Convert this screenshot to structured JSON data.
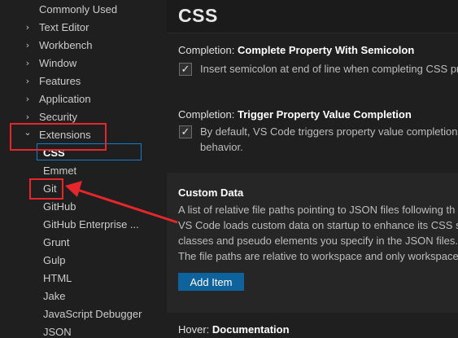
{
  "sidebar": {
    "items": [
      {
        "label": "Commonly Used",
        "chevron": ""
      },
      {
        "label": "Text Editor",
        "chevron": "›"
      },
      {
        "label": "Workbench",
        "chevron": "›"
      },
      {
        "label": "Window",
        "chevron": "›"
      },
      {
        "label": "Features",
        "chevron": "›"
      },
      {
        "label": "Application",
        "chevron": "›"
      },
      {
        "label": "Security",
        "chevron": "›"
      },
      {
        "label": "Extensions",
        "chevron": "⌄"
      }
    ],
    "extensions": [
      "CSS",
      "Emmet",
      "Git",
      "GitHub",
      "GitHub Enterprise ...",
      "Grunt",
      "Gulp",
      "HTML",
      "Jake",
      "JavaScript Debugger",
      "JSON"
    ]
  },
  "main": {
    "title": "CSS",
    "settings": [
      {
        "prefix": "Completion: ",
        "name": "Complete Property With Semicolon",
        "desc": [
          "Insert semicolon at end of line when completing CSS pr"
        ],
        "checked": true
      },
      {
        "prefix": "Completion: ",
        "name": "Trigger Property Value Completion",
        "desc": [
          "By default, VS Code triggers property value completion",
          "behavior."
        ],
        "checked": true
      },
      {
        "prefix": "",
        "name": "Custom Data",
        "desc": [
          "A list of relative file paths pointing to JSON files following th",
          "VS Code loads custom data on startup to enhance its CSS su",
          "classes and pseudo elements you specify in the JSON files.",
          "The file paths are relative to workspace and only workspace"
        ],
        "button": "Add Item"
      },
      {
        "prefix": "Hover: ",
        "name": "Documentation"
      }
    ]
  },
  "checkmark": "✓",
  "colors": {
    "annotation": "#e5262b",
    "accent": "#0e639c",
    "focus": "#0e7fd4"
  }
}
